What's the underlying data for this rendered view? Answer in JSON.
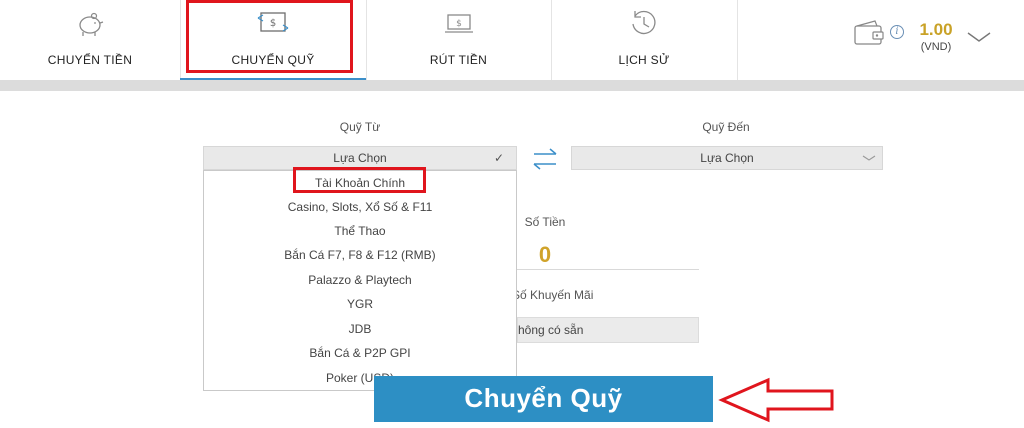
{
  "nav": {
    "tabs": [
      {
        "label": "CHUYỂN TIỀN",
        "icon": "piggy-bank-icon"
      },
      {
        "label": "CHUYỂN QUỸ",
        "icon": "money-transfer-icon"
      },
      {
        "label": "RÚT TIỀN",
        "icon": "cash-withdraw-icon"
      },
      {
        "label": "LỊCH SỬ",
        "icon": "history-clock-icon"
      }
    ],
    "active_tab": "CHUYỂN QUỸ"
  },
  "balance": {
    "amount": "1.00",
    "currency": "(VND)",
    "info": "i",
    "icons": [
      "wallet-icon",
      "info-icon",
      "chevron-down-icon"
    ]
  },
  "form": {
    "from_label": "Quỹ Từ",
    "to_label": "Quỹ Đến",
    "from_value": "Lựa Chọn",
    "from_check": "✓",
    "to_value": "Lựa Chọn",
    "from_options": [
      "Tài Khoản Chính",
      "Casino, Slots, Xổ Số & F11",
      "Thể Thao",
      "Bắn Cá F7, F8 & F12 (RMB)",
      "Palazzo & Playtech",
      "YGR",
      "JDB",
      "Bắn Cá & P2P GPI",
      "Poker (USD)"
    ],
    "amount_label": "Số Tiền",
    "amount_value": "0",
    "promo_label": "Số Khuyến Mãi",
    "promo_value": "hông có sẵn",
    "submit_label": "Chuyển Quỹ"
  },
  "colors": {
    "accent": "#2d8fc4",
    "gold": "#c9a227",
    "annotation_red": "#e0151d"
  }
}
